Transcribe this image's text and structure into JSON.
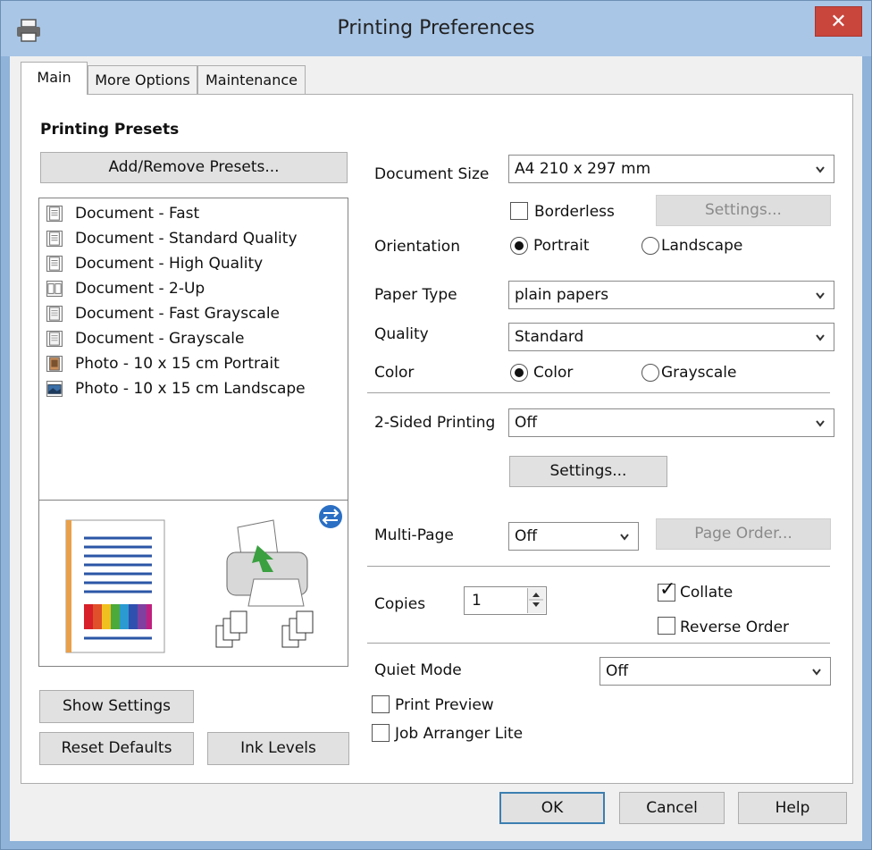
{
  "window": {
    "title": "Printing Preferences",
    "close_glyph": "✕",
    "icon": "printer-icon"
  },
  "tabs": [
    {
      "label": "Main",
      "active": true
    },
    {
      "label": "More Options",
      "active": false
    },
    {
      "label": "Maintenance",
      "active": false
    }
  ],
  "presets": {
    "heading": "Printing Presets",
    "add_remove_label": "Add/Remove Presets...",
    "items": [
      {
        "label": "Document - Fast",
        "icon": "document-fast-icon"
      },
      {
        "label": "Document - Standard Quality",
        "icon": "document-standard-icon"
      },
      {
        "label": "Document - High Quality",
        "icon": "document-high-icon"
      },
      {
        "label": "Document - 2-Up",
        "icon": "two-up-icon"
      },
      {
        "label": "Document - Fast Grayscale",
        "icon": "document-gray-fast-icon"
      },
      {
        "label": "Document - Grayscale",
        "icon": "document-gray-icon"
      },
      {
        "label": "Photo - 10 x 15 cm Portrait",
        "icon": "photo-portrait-icon"
      },
      {
        "label": "Photo - 10 x 15 cm Landscape",
        "icon": "photo-landscape-icon"
      }
    ]
  },
  "settings": {
    "document_size": {
      "label": "Document Size",
      "value": "A4 210 x 297 mm"
    },
    "borderless": {
      "label": "Borderless",
      "checked": false
    },
    "borderless_settings_label": "Settings...",
    "orientation": {
      "label": "Orientation",
      "portrait": "Portrait",
      "landscape": "Landscape",
      "selected": "Portrait"
    },
    "paper_type": {
      "label": "Paper Type",
      "value": "plain papers"
    },
    "quality": {
      "label": "Quality",
      "value": "Standard"
    },
    "color": {
      "label": "Color",
      "color_option": "Color",
      "grayscale_option": "Grayscale",
      "selected": "Color"
    },
    "two_sided": {
      "label": "2-Sided Printing",
      "value": "Off",
      "settings_label": "Settings..."
    },
    "multi_page": {
      "label": "Multi-Page",
      "value": "Off",
      "page_order_label": "Page Order..."
    },
    "copies": {
      "label": "Copies",
      "value": "1"
    },
    "collate": {
      "label": "Collate",
      "checked": true
    },
    "reverse_order": {
      "label": "Reverse Order",
      "checked": false
    },
    "quiet_mode": {
      "label": "Quiet Mode",
      "value": "Off"
    },
    "print_preview": {
      "label": "Print Preview",
      "checked": false
    },
    "job_arranger": {
      "label": "Job Arranger Lite",
      "checked": false
    }
  },
  "left_buttons": {
    "show_settings": "Show Settings",
    "reset_defaults": "Reset Defaults",
    "ink_levels": "Ink Levels"
  },
  "footer": {
    "ok": "OK",
    "cancel": "Cancel",
    "help": "Help"
  },
  "colors": {
    "titlebar": "#a9c6e6",
    "close": "#c9463d",
    "accent": "#3c7fb1"
  }
}
